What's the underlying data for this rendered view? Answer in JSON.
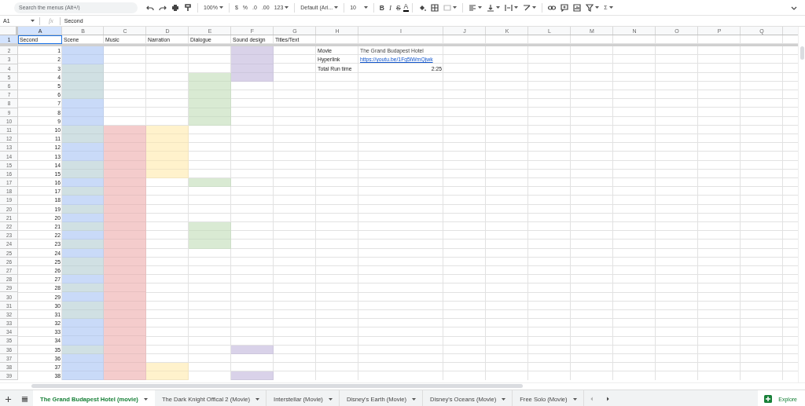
{
  "toolbar": {
    "search_placeholder": "Search the menus (Alt+/)",
    "zoom": "100%",
    "currency": "$",
    "percent": "%",
    "decrease_decimals": ".0",
    "increase_decimals": ".00",
    "number_format": "123",
    "font": "Default (Ari...",
    "font_size": "10",
    "bold": "B",
    "italic": "I",
    "strikethrough": "S",
    "text_color": "A",
    "functions": "Σ"
  },
  "formula_bar": {
    "cell_ref": "A1",
    "fx": "fx",
    "content": "Second"
  },
  "columns": [
    {
      "letter": "A",
      "selected": true
    },
    {
      "letter": "B",
      "selected": false
    },
    {
      "letter": "C",
      "selected": false
    },
    {
      "letter": "D",
      "selected": false
    },
    {
      "letter": "E",
      "selected": false
    },
    {
      "letter": "F",
      "selected": false
    },
    {
      "letter": "G",
      "selected": false
    },
    {
      "letter": "H",
      "selected": false
    },
    {
      "letter": "I",
      "selected": false
    },
    {
      "letter": "J",
      "selected": false
    },
    {
      "letter": "K",
      "selected": false
    },
    {
      "letter": "L",
      "selected": false
    },
    {
      "letter": "M",
      "selected": false
    },
    {
      "letter": "N",
      "selected": false
    },
    {
      "letter": "O",
      "selected": false
    },
    {
      "letter": "P",
      "selected": false
    },
    {
      "letter": "Q",
      "selected": false
    }
  ],
  "header_row": {
    "number": "1",
    "selected": true,
    "cells": [
      {
        "text": "Second",
        "selected": true
      },
      {
        "text": "Scene",
        "selected": false
      },
      {
        "text": "Music",
        "selected": false
      },
      {
        "text": "Narration",
        "selected": false
      },
      {
        "text": "Dialogue",
        "selected": false
      },
      {
        "text": "Sound design",
        "selected": false
      },
      {
        "text": "Titles/Text",
        "selected": false
      }
    ]
  },
  "info": [
    {
      "label": "Movie",
      "value": "The Grand Budapest Hotel",
      "kind": "text"
    },
    {
      "label": "Hyperlink",
      "value": "https://youtu.be/1Fg5iWmQjwk",
      "kind": "link"
    },
    {
      "label": "Total Run time",
      "value": "2:25",
      "kind": "number"
    }
  ],
  "rows": [
    {
      "number": "2",
      "second": "1",
      "scene": {
        "color": "#c9daf8"
      },
      "sound_design": {
        "color": "#d9d2e9"
      }
    },
    {
      "number": "3",
      "second": "2",
      "scene": {
        "color": "#c9daf8"
      },
      "sound_design": {
        "color": "#d9d2e9"
      }
    },
    {
      "number": "4",
      "second": "3",
      "scene": {
        "color": "#d0e0e3"
      },
      "sound_design": {
        "color": "#d9d2e9"
      }
    },
    {
      "number": "5",
      "second": "4",
      "scene": {
        "color": "#d0e0e3"
      },
      "dialogue": {
        "color": "#d9ead3"
      },
      "sound_design": {
        "color": "#d9d2e9"
      }
    },
    {
      "number": "6",
      "second": "5",
      "scene": {
        "color": "#d0e0e3"
      },
      "dialogue": {
        "color": "#d9ead3"
      }
    },
    {
      "number": "7",
      "second": "6",
      "scene": {
        "color": "#d0e0e3"
      },
      "dialogue": {
        "color": "#d9ead3"
      }
    },
    {
      "number": "8",
      "second": "7",
      "scene": {
        "color": "#c9daf8"
      },
      "dialogue": {
        "color": "#d9ead3"
      }
    },
    {
      "number": "9",
      "second": "8",
      "scene": {
        "color": "#c9daf8"
      },
      "dialogue": {
        "color": "#d9ead3"
      }
    },
    {
      "number": "10",
      "second": "9",
      "scene": {
        "color": "#c9daf8"
      },
      "dialogue": {
        "color": "#d9ead3"
      }
    },
    {
      "number": "11",
      "second": "10",
      "scene": {
        "color": "#d0e0e3"
      },
      "music": {
        "color": "#f4cccc"
      },
      "narration": {
        "color": "#fff2cc"
      }
    },
    {
      "number": "12",
      "second": "11",
      "scene": {
        "color": "#d0e0e3"
      },
      "music": {
        "color": "#f4cccc"
      },
      "narration": {
        "color": "#fff2cc"
      }
    },
    {
      "number": "13",
      "second": "12",
      "scene": {
        "color": "#c9daf8"
      },
      "music": {
        "color": "#f4cccc"
      },
      "narration": {
        "color": "#fff2cc"
      }
    },
    {
      "number": "14",
      "second": "13",
      "scene": {
        "color": "#c9daf8"
      },
      "music": {
        "color": "#f4cccc"
      },
      "narration": {
        "color": "#fff2cc"
      }
    },
    {
      "number": "15",
      "second": "14",
      "scene": {
        "color": "#d0e0e3"
      },
      "music": {
        "color": "#f4cccc"
      },
      "narration": {
        "color": "#fff2cc"
      }
    },
    {
      "number": "16",
      "second": "15",
      "scene": {
        "color": "#d0e0e3"
      },
      "music": {
        "color": "#f4cccc"
      },
      "narration": {
        "color": "#fff2cc"
      }
    },
    {
      "number": "17",
      "second": "16",
      "scene": {
        "color": "#c9daf8"
      },
      "music": {
        "color": "#f4cccc"
      },
      "dialogue": {
        "color": "#d9ead3"
      }
    },
    {
      "number": "18",
      "second": "17",
      "scene": {
        "color": "#d0e0e3"
      },
      "music": {
        "color": "#f4cccc"
      }
    },
    {
      "number": "19",
      "second": "18",
      "scene": {
        "color": "#c9daf8"
      },
      "music": {
        "color": "#f4cccc"
      }
    },
    {
      "number": "20",
      "second": "19",
      "scene": {
        "color": "#d0e0e3"
      },
      "music": {
        "color": "#f4cccc"
      }
    },
    {
      "number": "21",
      "second": "20",
      "scene": {
        "color": "#c9daf8"
      },
      "music": {
        "color": "#f4cccc"
      }
    },
    {
      "number": "22",
      "second": "21",
      "scene": {
        "color": "#d0e0e3"
      },
      "music": {
        "color": "#f4cccc"
      },
      "dialogue": {
        "color": "#d9ead3"
      }
    },
    {
      "number": "23",
      "second": "22",
      "scene": {
        "color": "#c9daf8"
      },
      "music": {
        "color": "#f4cccc"
      },
      "dialogue": {
        "color": "#d9ead3"
      }
    },
    {
      "number": "24",
      "second": "23",
      "scene": {
        "color": "#d0e0e3"
      },
      "music": {
        "color": "#f4cccc"
      },
      "dialogue": {
        "color": "#d9ead3"
      }
    },
    {
      "number": "25",
      "second": "24",
      "scene": {
        "color": "#c9daf8"
      },
      "music": {
        "color": "#f4cccc"
      }
    },
    {
      "number": "26",
      "second": "25",
      "scene": {
        "color": "#d0e0e3"
      },
      "music": {
        "color": "#f4cccc"
      }
    },
    {
      "number": "27",
      "second": "26",
      "scene": {
        "color": "#d0e0e3"
      },
      "music": {
        "color": "#f4cccc"
      }
    },
    {
      "number": "28",
      "second": "27",
      "scene": {
        "color": "#c9daf8"
      },
      "music": {
        "color": "#f4cccc"
      }
    },
    {
      "number": "29",
      "second": "28",
      "scene": {
        "color": "#d0e0e3"
      },
      "music": {
        "color": "#f4cccc"
      }
    },
    {
      "number": "30",
      "second": "29",
      "scene": {
        "color": "#c9daf8"
      },
      "music": {
        "color": "#f4cccc"
      }
    },
    {
      "number": "31",
      "second": "30",
      "scene": {
        "color": "#d0e0e3"
      },
      "music": {
        "color": "#f4cccc"
      }
    },
    {
      "number": "32",
      "second": "31",
      "scene": {
        "color": "#d0e0e3"
      },
      "music": {
        "color": "#f4cccc"
      }
    },
    {
      "number": "33",
      "second": "32",
      "scene": {
        "color": "#c9daf8"
      },
      "music": {
        "color": "#f4cccc"
      }
    },
    {
      "number": "34",
      "second": "33",
      "scene": {
        "color": "#c9daf8"
      },
      "music": {
        "color": "#f4cccc"
      }
    },
    {
      "number": "35",
      "second": "34",
      "scene": {
        "color": "#c9daf8"
      },
      "music": {
        "color": "#f4cccc"
      }
    },
    {
      "number": "36",
      "second": "35",
      "scene": {
        "color": "#d0e0e3"
      },
      "music": {
        "color": "#f4cccc"
      },
      "sound_design": {
        "color": "#d9d2e9"
      }
    },
    {
      "number": "37",
      "second": "36",
      "scene": {
        "color": "#c9daf8"
      },
      "music": {
        "color": "#f4cccc"
      }
    },
    {
      "number": "38",
      "second": "37",
      "scene": {
        "color": "#c9daf8"
      },
      "music": {
        "color": "#f4cccc"
      },
      "narration": {
        "color": "#fff2cc"
      }
    },
    {
      "number": "39",
      "second": "38",
      "scene": {
        "color": "#c9daf8"
      },
      "music": {
        "color": "#f4cccc"
      },
      "narration": {
        "color": "#fff2cc"
      },
      "sound_design": {
        "color": "#d9d2e9"
      }
    }
  ],
  "sheet_tabs": [
    {
      "label": "The Grand Budapest Hotel (movie)",
      "selected": true
    },
    {
      "label": "The Dark Knight Offical 2 (Movie)",
      "selected": false
    },
    {
      "label": "Interstellar (Movie)",
      "selected": false
    },
    {
      "label": "Disney's Earth (Movie)",
      "selected": false
    },
    {
      "label": "Disney's Oceans (Movie)",
      "selected": false
    },
    {
      "label": "Free Solo (Movie)",
      "selected": false
    }
  ],
  "explore": {
    "label": "Explore"
  }
}
